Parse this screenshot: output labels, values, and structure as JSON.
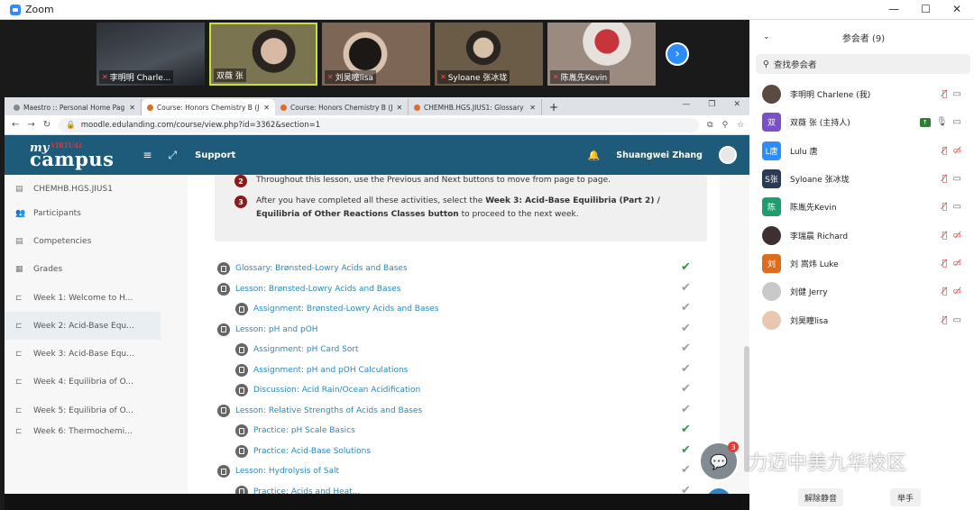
{
  "zoom": {
    "title": "Zoom",
    "controls": [
      "—",
      "☐",
      "✕"
    ]
  },
  "video_tiles": [
    {
      "name": "李明明 Charle...",
      "bg": "#3a3f45"
    },
    {
      "name": "双薇 张",
      "bg": "#6b6b4a",
      "highlight": true
    },
    {
      "name": "刘昊瞳lisa",
      "bg": "#5a4638"
    },
    {
      "name": "Syloane 张冰珑",
      "bg": "#4a4034"
    },
    {
      "name": "陈胤先Kevin",
      "bg": "#6e5a50"
    }
  ],
  "browser": {
    "tabs": [
      {
        "label": "Maestro :: Personal Home Pag",
        "active": false
      },
      {
        "label": "Course: Honors Chemistry B (J",
        "active": true
      },
      {
        "label": "Course: Honors Chemistry B (J",
        "active": false
      },
      {
        "label": "CHEMHB.HGS.JIUS1: Glossary",
        "active": false
      }
    ],
    "new_tab": "+",
    "url": "moodle.edulanding.com/course/view.php?id=3362&section=1"
  },
  "moodle": {
    "logo_my": "my",
    "logo_virtual": "VIRTUAL",
    "logo_campus": "campus",
    "support": "Support",
    "user": "Shuangwei Zhang",
    "sidebar": [
      {
        "label": "CHEMHB.HGS.JIUS1",
        "icon": "course-icon"
      },
      {
        "label": "Participants",
        "icon": "users-icon"
      },
      {
        "label": "Competencies",
        "icon": "list-icon"
      },
      {
        "label": "Grades",
        "icon": "table-icon"
      },
      {
        "label": "Week 1: Welcome to H...",
        "icon": "folder-icon"
      },
      {
        "label": "Week 2: Acid-Base Equ...",
        "icon": "folder-icon",
        "active": true
      },
      {
        "label": "Week 3: Acid-Base Equ...",
        "icon": "folder-icon"
      },
      {
        "label": "Week 4: Equilibria of O...",
        "icon": "folder-icon"
      },
      {
        "label": "Week 5: Equilibria of O...",
        "icon": "folder-icon"
      },
      {
        "label": "Week 6: Thermochemi...",
        "icon": "folder-icon"
      }
    ],
    "steps": [
      {
        "num": "2",
        "text": "Throughout this lesson, use the Previous and Next buttons to move from page to page."
      },
      {
        "num": "3",
        "text_a": "After you have completed all these activities, select the ",
        "text_b": "Week 3: Acid-Base Equilibria (Part 2) / Equilibria of Other Reactions Classes button",
        "text_c": " to proceed to the next week."
      }
    ],
    "activities": [
      {
        "label": "Glossary: Brønsted-Lowry Acids and Bases",
        "indent": 0,
        "done": true
      },
      {
        "label": "Lesson: Brønsted-Lowry Acids and Bases",
        "indent": 0,
        "done": false
      },
      {
        "label": "Assignment: Brønsted-Lowry Acids and Bases",
        "indent": 1,
        "done": false
      },
      {
        "label": "Lesson: pH and pOH",
        "indent": 0,
        "done": false
      },
      {
        "label": "Assignment: pH Card Sort",
        "indent": 1,
        "done": false
      },
      {
        "label": "Assignment: pH and pOH Calculations",
        "indent": 1,
        "done": false
      },
      {
        "label": "Discussion: Acid Rain/Ocean Acidification",
        "indent": 1,
        "done": false
      },
      {
        "label": "Lesson: Relative Strengths of Acids and Bases",
        "indent": 0,
        "done": false
      },
      {
        "label": "Practice: pH Scale Basics",
        "indent": 1,
        "done": true
      },
      {
        "label": "Practice: Acid-Base Solutions",
        "indent": 1,
        "done": true
      },
      {
        "label": "Lesson: Hydrolysis of Salt",
        "indent": 0,
        "done": false
      },
      {
        "label": "Practice: Acids and Heat...",
        "indent": 1,
        "done": false
      }
    ]
  },
  "participants_panel": {
    "title": "参会者 (9)",
    "search_placeholder": "查找参会者",
    "participants": [
      {
        "name": "李明明 Charlene (我)",
        "avatar": "",
        "color": "#5a4a40",
        "mic_off": true,
        "cam_off": false
      },
      {
        "name": "双薇 张 (主持人)",
        "avatar": "双",
        "color": "#7b4fc9",
        "mic_off": false,
        "cam_off": false,
        "sharing": true
      },
      {
        "name": "Lulu 唐",
        "avatar": "L唐",
        "color": "#2d8cff",
        "mic_off": true,
        "cam_off": true
      },
      {
        "name": "Syloane 张冰珑",
        "avatar": "S张",
        "color": "#2b3a55",
        "mic_off": true,
        "cam_off": false
      },
      {
        "name": "陈胤先Kevin",
        "avatar": "陈",
        "color": "#1e9e6e",
        "mic_off": true,
        "cam_off": false
      },
      {
        "name": "李瑞晨 Richard",
        "avatar": "",
        "color": "#3e3030",
        "mic_off": true,
        "cam_off": true
      },
      {
        "name": "刘 嵩炜 Luke",
        "avatar": "刘",
        "color": "#e06b1a",
        "mic_off": true,
        "cam_off": true
      },
      {
        "name": "刘健 Jerry",
        "avatar": "",
        "color": "#c9c9c9",
        "mic_off": true,
        "cam_off": true
      },
      {
        "name": "刘昊瞳lisa",
        "avatar": "",
        "color": "#e8c8b0",
        "mic_off": true,
        "cam_off": false
      }
    ],
    "unmute_all": "解除静音",
    "raise_hand": "举手"
  },
  "watermark": {
    "text": "力迈中美九华校区",
    "badge": "3"
  }
}
